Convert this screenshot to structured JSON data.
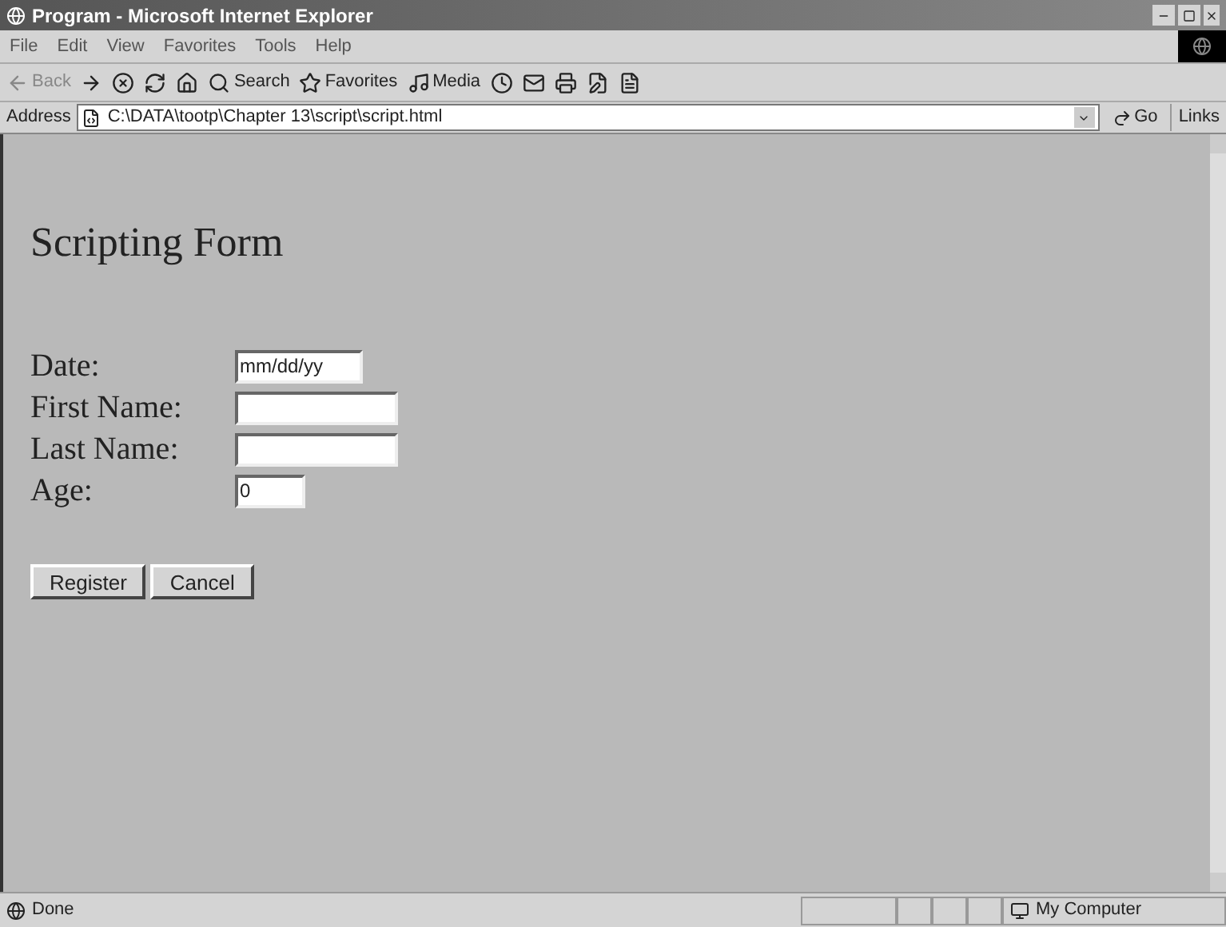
{
  "window": {
    "title": "Program - Microsoft Internet Explorer"
  },
  "menu": [
    "File",
    "Edit",
    "View",
    "Favorites",
    "Tools",
    "Help"
  ],
  "toolbar": [
    {
      "kind": "back",
      "label": "Back"
    },
    {
      "kind": "forward"
    },
    {
      "kind": "stop"
    },
    {
      "kind": "refresh"
    },
    {
      "kind": "home"
    },
    {
      "kind": "search",
      "label": "Search"
    },
    {
      "kind": "favorites",
      "label": "Favorites"
    },
    {
      "kind": "media",
      "label": "Media"
    },
    {
      "kind": "history"
    },
    {
      "kind": "mail"
    },
    {
      "kind": "print"
    },
    {
      "kind": "edit"
    },
    {
      "kind": "discuss"
    }
  ],
  "address": {
    "label": "Address",
    "value": "C:\\DATA\\tootp\\Chapter 13\\script\\script.html",
    "go": "Go",
    "links": "Links"
  },
  "page": {
    "heading": "Scripting Form",
    "fields": [
      {
        "label": "Date:",
        "value": "mm/dd/yy"
      },
      {
        "label": "First Name:"
      },
      {
        "label": "Last Name:"
      },
      {
        "label": "Age:",
        "value": "0"
      }
    ],
    "buttons": [
      "Register",
      "Cancel"
    ]
  },
  "status_bar": {
    "text": "Done",
    "zone": "My Computer"
  }
}
